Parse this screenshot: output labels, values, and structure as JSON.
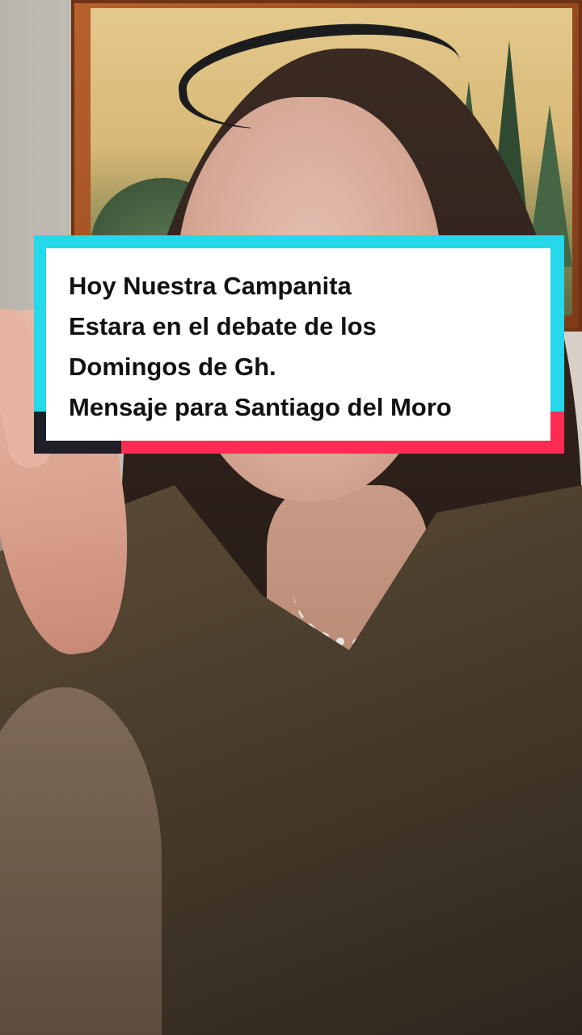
{
  "caption": {
    "lines": [
      "Hoy Nuestra Campanita",
      "Estara en el debate de los",
      "Domingos de Gh.",
      "Mensaje para Santiago del Moro"
    ]
  },
  "colors": {
    "caption_background": "#ffffff",
    "caption_text": "#111111",
    "accent_cyan": "#25d8ea",
    "accent_red": "#fe2c55",
    "accent_dark": "#1f1f27"
  }
}
